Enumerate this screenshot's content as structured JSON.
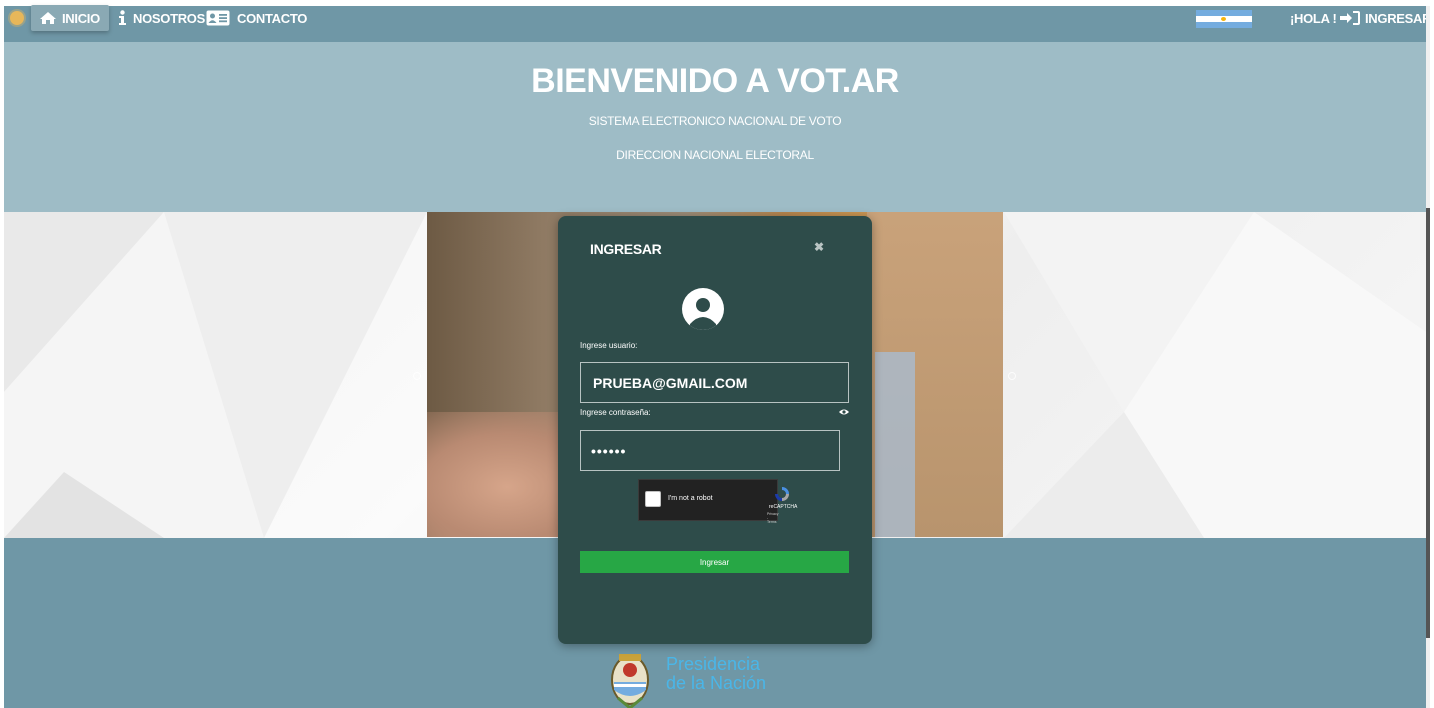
{
  "navbar": {
    "items": [
      {
        "label": "INICIO",
        "icon": "home-icon",
        "active": true
      },
      {
        "label": "NOSOTROS",
        "icon": "info-icon"
      },
      {
        "label": "CONTACTO",
        "icon": "contact-card-icon"
      }
    ],
    "greeting": "¡HOLA !",
    "login_label": "INGRESAR",
    "flag_colors": [
      "#74acdf",
      "#ffffff",
      "#74acdf"
    ],
    "accent": "#6f97a6"
  },
  "hero": {
    "title": "BIENVENIDO A VOT.AR",
    "subtitle1": "SISTEMA ELECTRONICO NACIONAL DE VOTO",
    "subtitle2": "DIRECCION NACIONAL ELECTORAL"
  },
  "modal": {
    "title": "INGRESAR",
    "close_icon": "close-icon",
    "user_label": "Ingrese usuario:",
    "user_value": "PRUEBA@GMAIL.COM",
    "password_label": "Ingrese contraseña:",
    "password_value": "••••••",
    "captcha_label": "I'm not a robot",
    "captcha_brand": "reCAPTCHA",
    "captcha_terms": "Privacy - Terms",
    "submit_label": "Ingresar",
    "bg_color": "#2e4c4a",
    "button_color": "#27a745"
  },
  "footer": {
    "line1": "Presidencia",
    "line2": "de la Nación",
    "text_color": "#4ab6e8"
  }
}
